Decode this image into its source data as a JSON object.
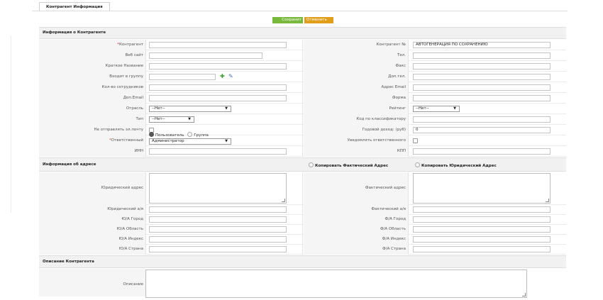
{
  "tab": {
    "label": "Контрагент Информация"
  },
  "buttons": {
    "save": "Сохранит",
    "cancel": "Отменить"
  },
  "sections": {
    "info": "Информация о Контрагенте",
    "address": "Информация об адресе",
    "description": "Описание Контрагента"
  },
  "copy": {
    "actual": "Копировать Фактический Адрес",
    "legal": "Копировать Юридический Адрес"
  },
  "left": {
    "contractor_star": "*",
    "contractor": "Контрагент",
    "website": "Веб сайт",
    "short_name": "Краткое Название",
    "group": "Входит в группу",
    "employees": "Кол-во сотрудников",
    "extra_email": "Доп.Email",
    "industry": "Отрасль",
    "industry_value": "--Нет--",
    "type": "Тип",
    "type_value": "--Нет--",
    "no_email": "Не отправлять эл.почту",
    "responsible_star": "*",
    "responsible": "Ответственный",
    "user_opt": "Пользователь",
    "group_opt": "Группа",
    "responsible_value": "Администратор",
    "inn": "ИНН"
  },
  "right": {
    "contractor_no": "Контрагент №",
    "contractor_no_value": "АВТОГЕНЕРАЦИЯ ПО СОХРАНЕНИЮ",
    "phone": "Тел.",
    "fax": "Факс",
    "extra_phone": "Доп.тел.",
    "email": "Адрес Email",
    "form": "Форма",
    "rating": "Рейтинг",
    "rating_value": "--Нет--",
    "classifier": "Код по классификатору",
    "income": "Годовой доход: (руб)",
    "income_value": "0",
    "notify": "Уведомлять ответственного",
    "kpp": "КПП"
  },
  "address_left": {
    "legal_address": "Юридический адрес",
    "legal_po": "Юридический а/я",
    "city": "Ю/А Город",
    "region": "Ю/А Область",
    "zip": "Ю/А Индекс",
    "country": "Ю/А Страна"
  },
  "address_right": {
    "actual_address": "Фактический адрес",
    "actual_po": "Фактический а/я",
    "city": "Ф/А Город",
    "region": "Ф/А Область",
    "zip": "Ф/А Индекс",
    "country": "Ф/А Страна"
  },
  "desc": {
    "label": "Описание"
  },
  "icons": {
    "add": "plus-icon",
    "select": "select-icon"
  },
  "colors": {
    "save": "#78b83a",
    "cancel": "#e09e1a",
    "required": "#dd3333"
  }
}
